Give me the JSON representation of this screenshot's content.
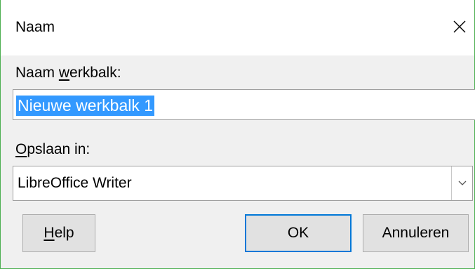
{
  "dialog": {
    "title": "Naam",
    "close_icon": "close-icon"
  },
  "name_field": {
    "label_prefix": "Naam ",
    "label_accel": "w",
    "label_suffix": "erkbalk:",
    "value": "Nieuwe werkbalk 1",
    "selected": true
  },
  "save_in": {
    "label_accel": "O",
    "label_suffix": "pslaan in:",
    "value": "LibreOffice Writer",
    "dropdown_icon": "chevron-down-icon"
  },
  "buttons": {
    "help_accel": "H",
    "help_suffix": "elp",
    "ok": "OK",
    "cancel": "Annuleren"
  },
  "colors": {
    "selection": "#3399ff",
    "default_button_border": "#0078d7",
    "window_border": "#4caf50"
  }
}
